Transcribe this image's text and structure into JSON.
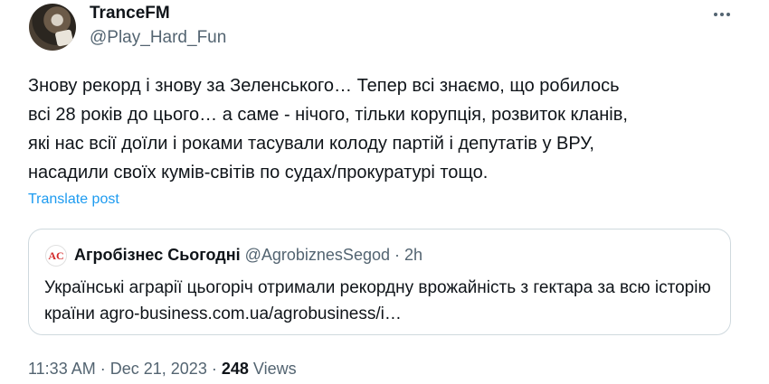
{
  "author": {
    "display_name": "TranceFM",
    "handle": "@Play_Hard_Fun"
  },
  "more_icon": "ellipsis-horizontal-icon",
  "tweet": {
    "text": "Знову рекорд і знову за Зеленського… Тепер всі знаємо, що робилось\nвсі 28 років до цього… а саме - нічого, тільки корупція, розвиток кланів,\nякі нас всії доїли і роками тасували колоду партій і депутатів у ВРУ,\nнасадили своїх кумів-світів по судах/прокуратурі тощо.",
    "translate_label": "Translate post"
  },
  "quote": {
    "avatar_text": "AC",
    "name": "Агробізнес Сьогодні",
    "handle": "@AgrobiznesSegod",
    "dot": "·",
    "time": "2h",
    "text": "Українські аграрії цьогоріч отримали рекордну врожайність з гектара за всю історію країни agro-business.com.ua/agrobusiness/i…"
  },
  "meta": {
    "time": "11:33 AM",
    "sep1": "·",
    "date": "Dec 21, 2023",
    "sep2": "·",
    "views_count": "248",
    "views_label": "Views"
  },
  "colors": {
    "accent": "#1d9bf0",
    "secondary_text": "#536471",
    "primary_text": "#0f1419",
    "border": "#cfd9de"
  }
}
